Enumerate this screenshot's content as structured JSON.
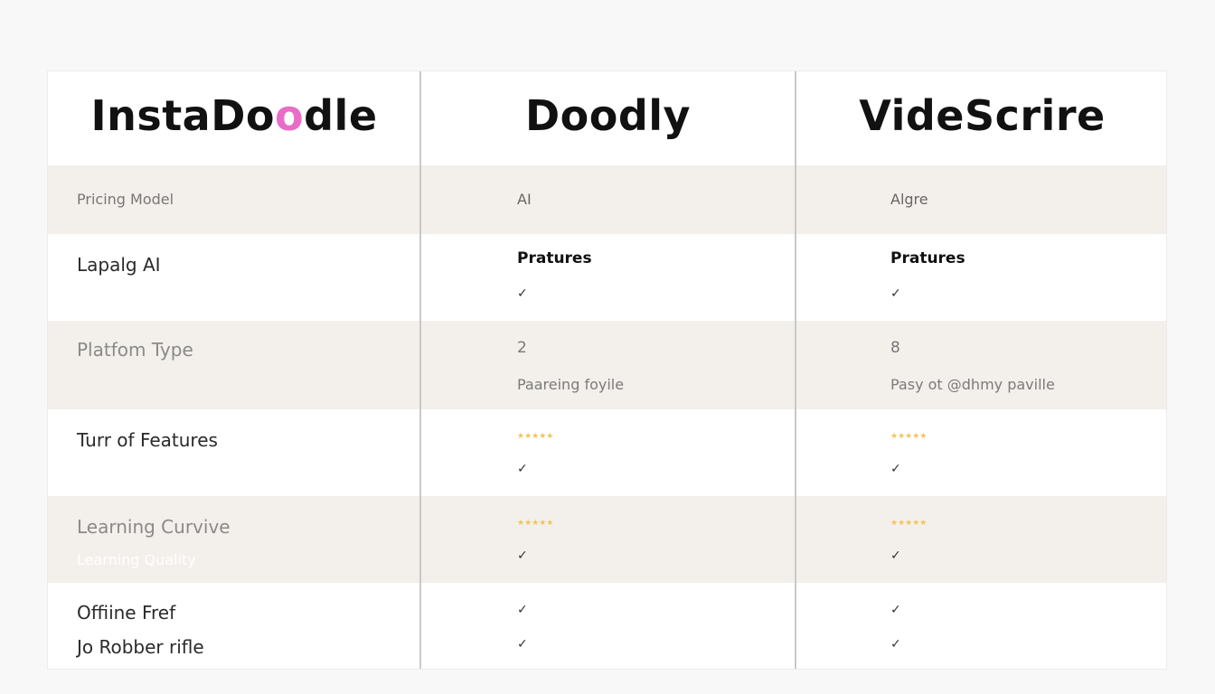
{
  "columns": {
    "col1": {
      "name_start": "InstaDo",
      "name_accent": "o",
      "name_end": "dle"
    },
    "col2": {
      "name": "Doodly"
    },
    "col3": {
      "name": "VideScrire"
    }
  },
  "rows": {
    "pricing": {
      "label": "Pricing Model",
      "col2": "AI",
      "col3": "Algre"
    },
    "lapalg": {
      "label": "Lapalg AI",
      "col2_title": "Pratures",
      "col3_title": "Pratures"
    },
    "platform": {
      "label": "Platfom Type",
      "col2_num": "2",
      "col2_text": "Paareing foyile",
      "col3_num": "8",
      "col3_text": "Pasy ot @dhmy paville"
    },
    "features": {
      "label": "Turr of Features",
      "col2_stars": "★★★★★",
      "col3_stars": "★★★★★"
    },
    "learning": {
      "label": "Learning Curvive",
      "sublabel": "Learning Quality",
      "col2_stars": "★★★★★",
      "col3_stars": "★★★★★"
    },
    "offline": {
      "label": "Offiine Fref",
      "label2": "Jo Robber rifle"
    }
  },
  "check_glyph": "✓",
  "colors": {
    "shaded_row": "#f3efeb",
    "accent": "#e86cc8",
    "stars": "#f0c55b",
    "divider": "#c9c9c9"
  }
}
